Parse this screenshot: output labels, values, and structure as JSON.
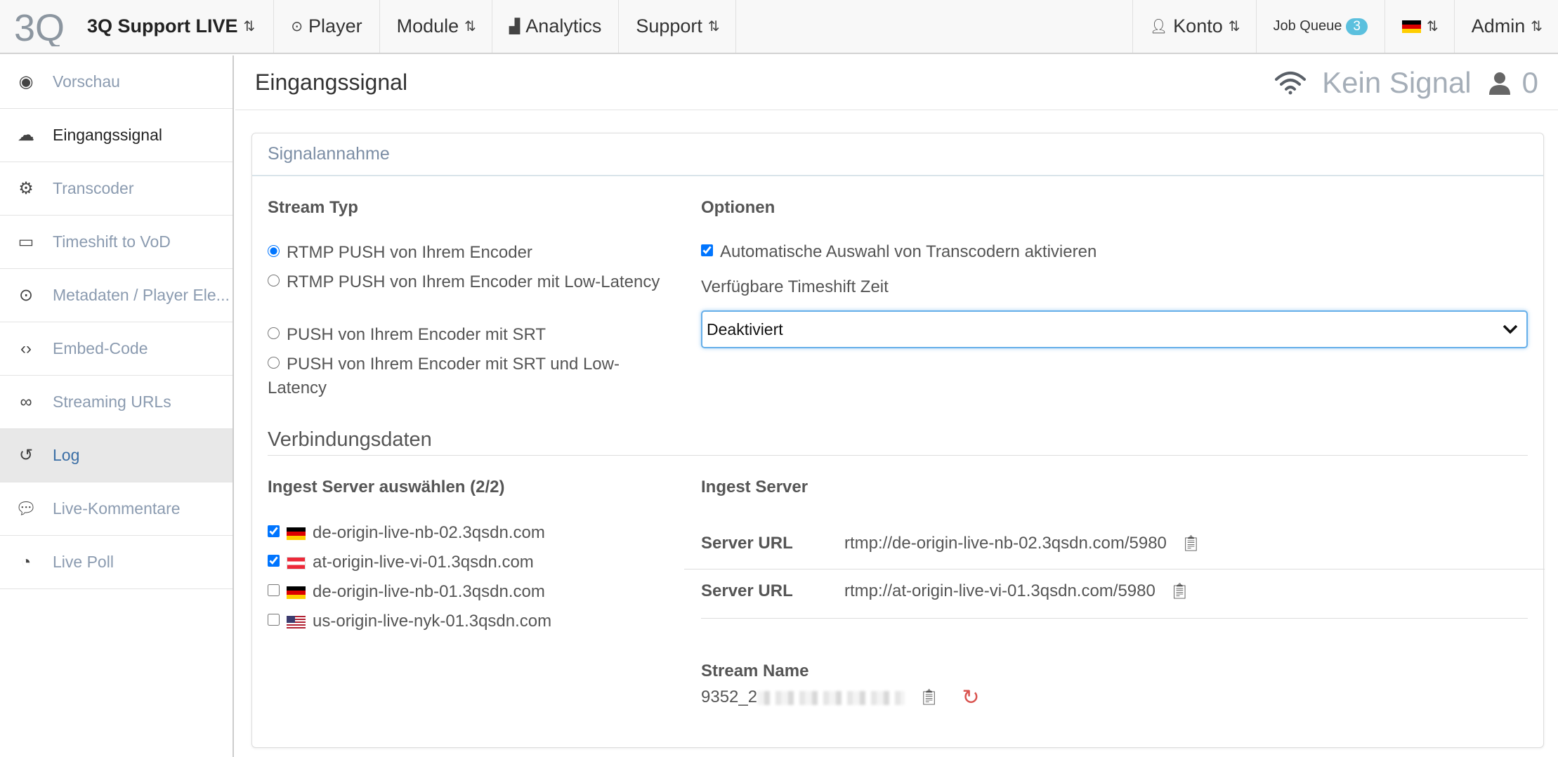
{
  "topbar": {
    "brand_logo_text": "3Q",
    "brand_title": "3Q Support LIVE",
    "menu": {
      "player": "Player",
      "module": "Module",
      "analytics": "Analytics",
      "support": "Support"
    },
    "right": {
      "konto": "Konto",
      "job_queue": "Job Queue",
      "job_queue_count": "3",
      "admin": "Admin"
    }
  },
  "sidebar": {
    "items": [
      {
        "label": "Vorschau",
        "icon": "eye-icon"
      },
      {
        "label": "Eingangssignal",
        "icon": "cloud-upload-icon"
      },
      {
        "label": "Transcoder",
        "icon": "cogs-icon"
      },
      {
        "label": "Timeshift to VoD",
        "icon": "laptop-icon"
      },
      {
        "label": "Metadaten / Player Ele...",
        "icon": "play-circle-icon"
      },
      {
        "label": "Embed-Code",
        "icon": "code-icon"
      },
      {
        "label": "Streaming URLs",
        "icon": "infinity-icon"
      },
      {
        "label": "Log",
        "icon": "history-icon"
      },
      {
        "label": "Live-Kommentare",
        "icon": "comments-icon"
      },
      {
        "label": "Live Poll",
        "icon": "pie-chart-icon"
      }
    ]
  },
  "header": {
    "title": "Eingangssignal",
    "signal_status": "Kein Signal",
    "viewer_count": "0"
  },
  "panel": {
    "heading": "Signalannahme",
    "stream_typ": {
      "label": "Stream Typ",
      "options": [
        "RTMP PUSH von Ihrem Encoder",
        "RTMP PUSH von Ihrem Encoder mit Low-Latency",
        "PUSH von Ihrem Encoder mit SRT",
        "PUSH von Ihrem Encoder mit SRT und Low-Latency"
      ],
      "selected_index": 0
    },
    "optionen": {
      "label": "Optionen",
      "auto_transcoder": "Automatische Auswahl von Transcodern aktivieren",
      "auto_transcoder_checked": true,
      "timeshift_label": "Verfügbare Timeshift Zeit",
      "timeshift_value": "Deaktiviert"
    },
    "verbindungsdaten": {
      "title": "Verbindungsdaten",
      "ingest_select_label": "Ingest Server auswählen (2/2)",
      "servers": [
        {
          "name": "de-origin-live-nb-02.3qsdn.com",
          "flag": "de",
          "checked": true
        },
        {
          "name": "at-origin-live-vi-01.3qsdn.com",
          "flag": "at",
          "checked": true
        },
        {
          "name": "de-origin-live-nb-01.3qsdn.com",
          "flag": "de",
          "checked": false
        },
        {
          "name": "us-origin-live-nyk-01.3qsdn.com",
          "flag": "us",
          "checked": false
        }
      ],
      "ingest_server_label": "Ingest Server",
      "server_url_label": "Server URL",
      "server_urls": [
        "rtmp://de-origin-live-nb-02.3qsdn.com/5980",
        "rtmp://at-origin-live-vi-01.3qsdn.com/5980"
      ],
      "stream_name_label": "Stream Name",
      "stream_name_prefix": "9352_2"
    }
  }
}
